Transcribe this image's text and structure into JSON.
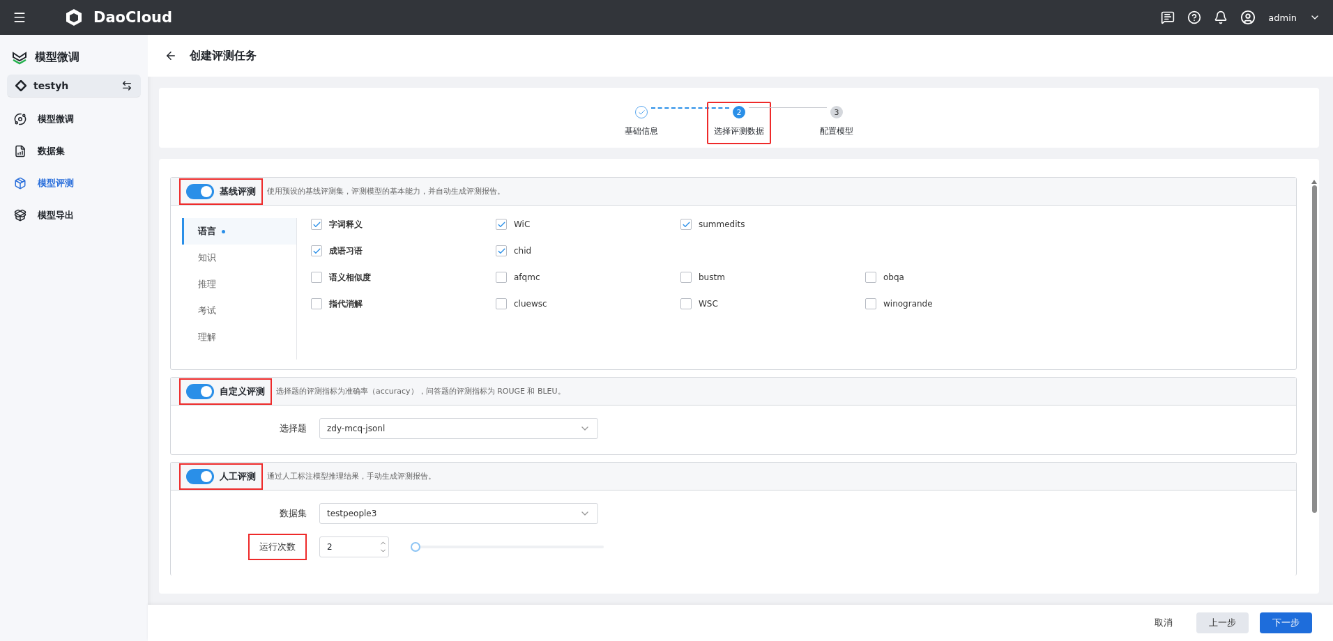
{
  "topbar": {
    "brand": "DaoCloud",
    "user": "admin"
  },
  "sidebar": {
    "title": "模型微调",
    "workspace": "testyh",
    "items": [
      {
        "label": "模型微调",
        "selected": false
      },
      {
        "label": "数据集",
        "selected": false
      },
      {
        "label": "模型评测",
        "selected": true
      },
      {
        "label": "模型导出",
        "selected": false
      }
    ]
  },
  "page": {
    "title": "创建评测任务"
  },
  "steps": [
    {
      "label": "基础信息",
      "done": true,
      "selected": false,
      "highlighted": false
    },
    {
      "number": "2",
      "label": "选择评测数据",
      "done": false,
      "selected": true,
      "highlighted": true
    },
    {
      "number": "3",
      "label": "配置模型",
      "done": false,
      "selected": false,
      "highlighted": false
    }
  ],
  "baseline": {
    "title": "基线评测",
    "on": true,
    "highlighted": true,
    "description": "使用预设的基线评测集，评测模型的基本能力，并自动生成评测报告。",
    "categories": [
      {
        "label": "语言",
        "selected": true,
        "dot": true
      },
      {
        "label": "知识",
        "selected": false,
        "dot": false
      },
      {
        "label": "推理",
        "selected": false,
        "dot": false
      },
      {
        "label": "考试",
        "selected": false,
        "dot": false
      },
      {
        "label": "理解",
        "selected": false,
        "dot": false
      }
    ],
    "rows": [
      [
        {
          "label": "字词释义",
          "checked": true
        },
        {
          "label": "WiC",
          "checked": true
        },
        {
          "label": "summedits",
          "checked": true
        }
      ],
      [
        {
          "label": "成语习语",
          "checked": true
        },
        {
          "label": "chid",
          "checked": true
        }
      ],
      [
        {
          "label": "语义相似度",
          "checked": false
        },
        {
          "label": "afqmc",
          "checked": false
        },
        {
          "label": "bustm",
          "checked": false
        },
        {
          "label": "obqa",
          "checked": false
        }
      ],
      [
        {
          "label": "指代消解",
          "checked": false
        },
        {
          "label": "cluewsc",
          "checked": false
        },
        {
          "label": "WSC",
          "checked": false
        },
        {
          "label": "winogrande",
          "checked": false
        }
      ]
    ]
  },
  "custom": {
    "title": "自定义评测",
    "on": true,
    "highlighted": true,
    "description": "选择题的评测指标为准确率（accuracy），问答题的评测指标为 ROUGE 和 BLEU。",
    "field": {
      "label": "选择题",
      "value": "zdy-mcq-jsonl"
    }
  },
  "manual": {
    "title": "人工评测",
    "on": true,
    "highlighted": true,
    "description": "通过人工标注模型推理结果，手动生成评测报告。",
    "field": {
      "label": "数据集",
      "value": "testpeople3"
    },
    "runs": {
      "label": "运行次数",
      "value": "2",
      "level": 0,
      "highlighted": true
    }
  },
  "footer": {
    "cancel": "取消",
    "prev": "上一步",
    "next": "下一步"
  }
}
